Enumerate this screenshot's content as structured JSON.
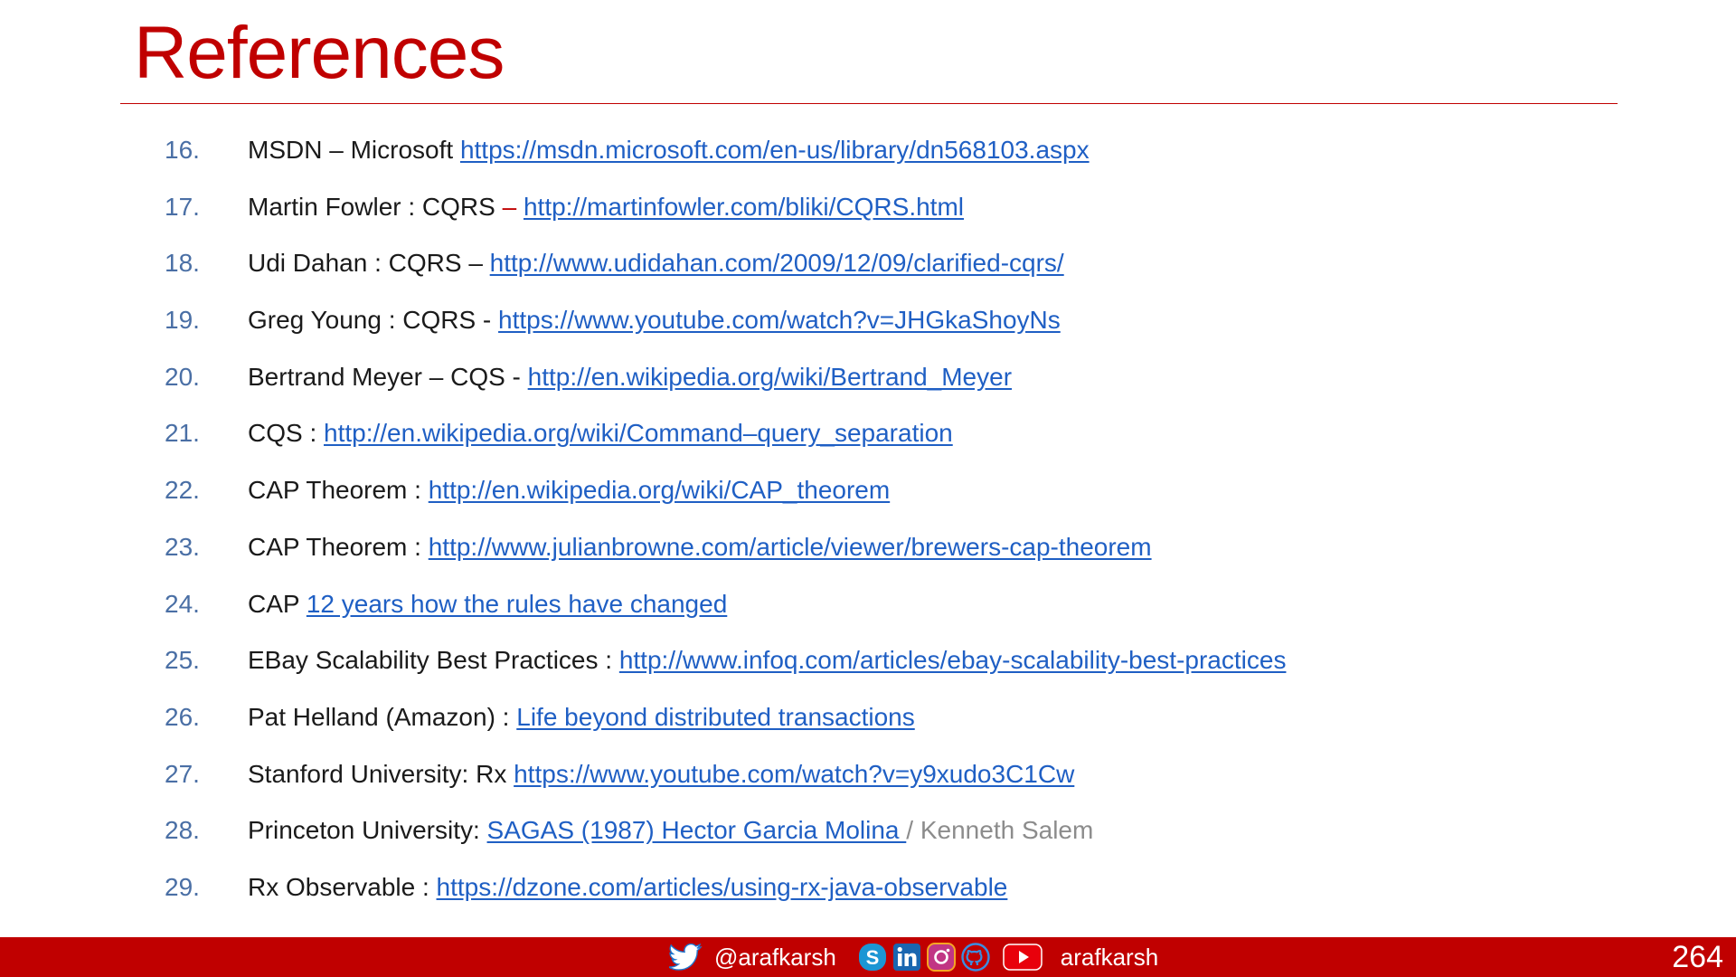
{
  "slide": {
    "title": "References",
    "page_number": "264"
  },
  "references": [
    {
      "num": "16.",
      "text": "MSDN – Microsoft ",
      "link": "https://msdn.microsoft.com/en-us/library/dn568103.aspx"
    },
    {
      "num": "17.",
      "text": "Martin Fowler : CQRS ",
      "sep": "– ",
      "link": "http://martinfowler.com/bliki/CQRS.html"
    },
    {
      "num": "18.",
      "text": "Udi Dahan : CQRS – ",
      "link": "http://www.udidahan.com/2009/12/09/clarified-cqrs/"
    },
    {
      "num": "19.",
      "text": "Greg Young : CQRS - ",
      "link": "https://www.youtube.com/watch?v=JHGkaShoyNs"
    },
    {
      "num": "20.",
      "text": "Bertrand Meyer – CQS - ",
      "link": "http://en.wikipedia.org/wiki/Bertrand_Meyer"
    },
    {
      "num": "21.",
      "text": "CQS : ",
      "link": "http://en.wikipedia.org/wiki/Command–query_separation"
    },
    {
      "num": "22.",
      "text": "CAP Theorem : ",
      "link": "http://en.wikipedia.org/wiki/CAP_theorem"
    },
    {
      "num": "23.",
      "text": "CAP Theorem : ",
      "link": "http://www.julianbrowne.com/article/viewer/brewers-cap-theorem"
    },
    {
      "num": "24.",
      "text": "CAP ",
      "link": "12 years how the rules have changed"
    },
    {
      "num": "25.",
      "text": "EBay Scalability Best Practices : ",
      "link": "http://www.infoq.com/articles/ebay-scalability-best-practices"
    },
    {
      "num": "26.",
      "text": "Pat Helland  (Amazon) : ",
      "link": "Life beyond distributed transactions"
    },
    {
      "num": "27.",
      "text": "Stanford University: Rx ",
      "link": "https://www.youtube.com/watch?v=y9xudo3C1Cw"
    },
    {
      "num": "28.",
      "text": "Princeton University: ",
      "link": "SAGAS (1987) Hector Garcia Molina ",
      "trail": "/ Kenneth Salem"
    },
    {
      "num": "29.",
      "text": "Rx Observable : ",
      "link": "https://dzone.com/articles/using-rx-java-observable"
    }
  ],
  "footer": {
    "twitter_handle": "@arafkarsh",
    "social_handle": "arafkarsh",
    "icons": [
      "twitter-icon",
      "skype-icon",
      "linkedin-icon",
      "instagram-icon",
      "github-icon",
      "youtube-icon"
    ],
    "bar_color": "#c00000"
  },
  "colors": {
    "title": "#c00000",
    "number": "#4a6fa5",
    "link": "#1f5fc4",
    "text": "#1a1a1a"
  }
}
